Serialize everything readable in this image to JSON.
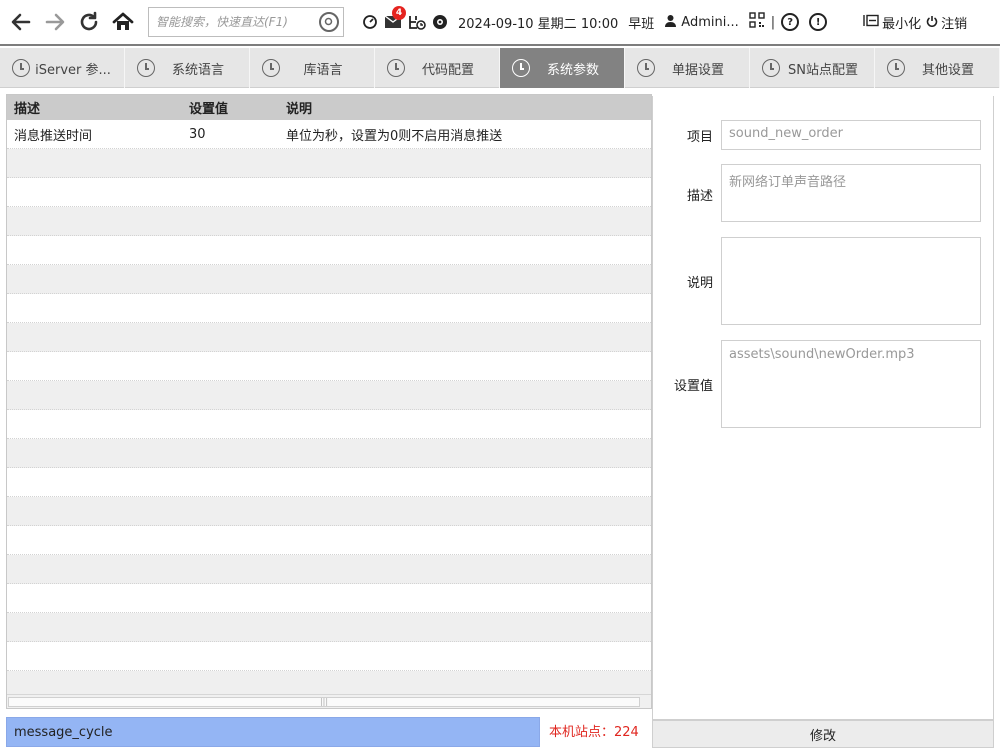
{
  "toolbar": {
    "back_icon": "arrow-left-icon",
    "forward_icon": "arrow-right-icon",
    "refresh_icon": "refresh-icon",
    "home_icon": "home-icon",
    "search_placeholder": "智能搜索，快速直达(F1)",
    "message_badge": "4",
    "datetime": "2024-09-10 星期二 10:00",
    "shift": "早班",
    "user": "Admini...",
    "separator": "|",
    "help_glyph": "?",
    "info_glyph": "!",
    "minimize_label": "最小化",
    "logout_label": "注销"
  },
  "tabs": [
    {
      "label": "iServer 参...",
      "active": false
    },
    {
      "label": "系统语言",
      "active": false
    },
    {
      "label": "库语言",
      "active": false
    },
    {
      "label": "代码配置",
      "active": false
    },
    {
      "label": "系统参数",
      "active": true
    },
    {
      "label": "单据设置",
      "active": false
    },
    {
      "label": "SN站点配置",
      "active": false
    },
    {
      "label": "其他设置",
      "active": false
    }
  ],
  "grid": {
    "columns": [
      "描述",
      "设置值",
      "说明"
    ],
    "rows": [
      {
        "desc": "消息推送时间",
        "value": "30",
        "note": "单位为秒，设置为0则不启用消息推送"
      }
    ],
    "scroll_grip": "|||"
  },
  "bottom": {
    "code_value": "message_cycle",
    "site_label": "本机站点：224"
  },
  "form": {
    "item_label": "项目",
    "item_value": "sound_new_order",
    "desc_label": "描述",
    "desc_value": "新网络订单声音路径",
    "note_label": "说明",
    "note_value": "",
    "setting_label": "设置值",
    "setting_value": "assets\\sound\\newOrder.mp3",
    "modify_button": "修改"
  },
  "colors": {
    "active_tab": "#828282",
    "code_field": "#94b5f4",
    "site_label": "#e0261f",
    "badge": "#e52420"
  }
}
